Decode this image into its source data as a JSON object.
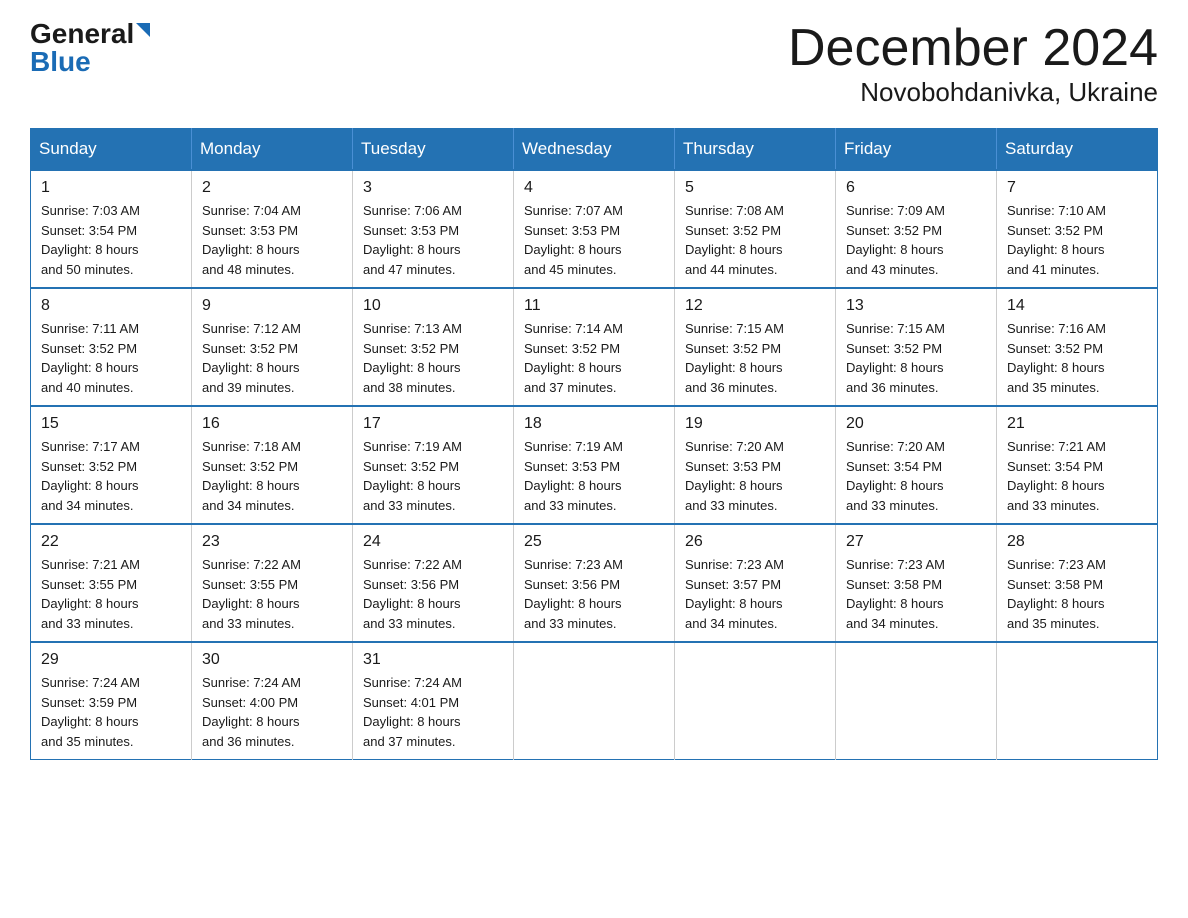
{
  "logo": {
    "general": "General",
    "blue": "Blue"
  },
  "header": {
    "month": "December 2024",
    "location": "Novobohdanivka, Ukraine"
  },
  "days_of_week": [
    "Sunday",
    "Monday",
    "Tuesday",
    "Wednesday",
    "Thursday",
    "Friday",
    "Saturday"
  ],
  "weeks": [
    [
      {
        "day": "1",
        "info": "Sunrise: 7:03 AM\nSunset: 3:54 PM\nDaylight: 8 hours\nand 50 minutes."
      },
      {
        "day": "2",
        "info": "Sunrise: 7:04 AM\nSunset: 3:53 PM\nDaylight: 8 hours\nand 48 minutes."
      },
      {
        "day": "3",
        "info": "Sunrise: 7:06 AM\nSunset: 3:53 PM\nDaylight: 8 hours\nand 47 minutes."
      },
      {
        "day": "4",
        "info": "Sunrise: 7:07 AM\nSunset: 3:53 PM\nDaylight: 8 hours\nand 45 minutes."
      },
      {
        "day": "5",
        "info": "Sunrise: 7:08 AM\nSunset: 3:52 PM\nDaylight: 8 hours\nand 44 minutes."
      },
      {
        "day": "6",
        "info": "Sunrise: 7:09 AM\nSunset: 3:52 PM\nDaylight: 8 hours\nand 43 minutes."
      },
      {
        "day": "7",
        "info": "Sunrise: 7:10 AM\nSunset: 3:52 PM\nDaylight: 8 hours\nand 41 minutes."
      }
    ],
    [
      {
        "day": "8",
        "info": "Sunrise: 7:11 AM\nSunset: 3:52 PM\nDaylight: 8 hours\nand 40 minutes."
      },
      {
        "day": "9",
        "info": "Sunrise: 7:12 AM\nSunset: 3:52 PM\nDaylight: 8 hours\nand 39 minutes."
      },
      {
        "day": "10",
        "info": "Sunrise: 7:13 AM\nSunset: 3:52 PM\nDaylight: 8 hours\nand 38 minutes."
      },
      {
        "day": "11",
        "info": "Sunrise: 7:14 AM\nSunset: 3:52 PM\nDaylight: 8 hours\nand 37 minutes."
      },
      {
        "day": "12",
        "info": "Sunrise: 7:15 AM\nSunset: 3:52 PM\nDaylight: 8 hours\nand 36 minutes."
      },
      {
        "day": "13",
        "info": "Sunrise: 7:15 AM\nSunset: 3:52 PM\nDaylight: 8 hours\nand 36 minutes."
      },
      {
        "day": "14",
        "info": "Sunrise: 7:16 AM\nSunset: 3:52 PM\nDaylight: 8 hours\nand 35 minutes."
      }
    ],
    [
      {
        "day": "15",
        "info": "Sunrise: 7:17 AM\nSunset: 3:52 PM\nDaylight: 8 hours\nand 34 minutes."
      },
      {
        "day": "16",
        "info": "Sunrise: 7:18 AM\nSunset: 3:52 PM\nDaylight: 8 hours\nand 34 minutes."
      },
      {
        "day": "17",
        "info": "Sunrise: 7:19 AM\nSunset: 3:52 PM\nDaylight: 8 hours\nand 33 minutes."
      },
      {
        "day": "18",
        "info": "Sunrise: 7:19 AM\nSunset: 3:53 PM\nDaylight: 8 hours\nand 33 minutes."
      },
      {
        "day": "19",
        "info": "Sunrise: 7:20 AM\nSunset: 3:53 PM\nDaylight: 8 hours\nand 33 minutes."
      },
      {
        "day": "20",
        "info": "Sunrise: 7:20 AM\nSunset: 3:54 PM\nDaylight: 8 hours\nand 33 minutes."
      },
      {
        "day": "21",
        "info": "Sunrise: 7:21 AM\nSunset: 3:54 PM\nDaylight: 8 hours\nand 33 minutes."
      }
    ],
    [
      {
        "day": "22",
        "info": "Sunrise: 7:21 AM\nSunset: 3:55 PM\nDaylight: 8 hours\nand 33 minutes."
      },
      {
        "day": "23",
        "info": "Sunrise: 7:22 AM\nSunset: 3:55 PM\nDaylight: 8 hours\nand 33 minutes."
      },
      {
        "day": "24",
        "info": "Sunrise: 7:22 AM\nSunset: 3:56 PM\nDaylight: 8 hours\nand 33 minutes."
      },
      {
        "day": "25",
        "info": "Sunrise: 7:23 AM\nSunset: 3:56 PM\nDaylight: 8 hours\nand 33 minutes."
      },
      {
        "day": "26",
        "info": "Sunrise: 7:23 AM\nSunset: 3:57 PM\nDaylight: 8 hours\nand 34 minutes."
      },
      {
        "day": "27",
        "info": "Sunrise: 7:23 AM\nSunset: 3:58 PM\nDaylight: 8 hours\nand 34 minutes."
      },
      {
        "day": "28",
        "info": "Sunrise: 7:23 AM\nSunset: 3:58 PM\nDaylight: 8 hours\nand 35 minutes."
      }
    ],
    [
      {
        "day": "29",
        "info": "Sunrise: 7:24 AM\nSunset: 3:59 PM\nDaylight: 8 hours\nand 35 minutes."
      },
      {
        "day": "30",
        "info": "Sunrise: 7:24 AM\nSunset: 4:00 PM\nDaylight: 8 hours\nand 36 minutes."
      },
      {
        "day": "31",
        "info": "Sunrise: 7:24 AM\nSunset: 4:01 PM\nDaylight: 8 hours\nand 37 minutes."
      },
      {
        "day": "",
        "info": ""
      },
      {
        "day": "",
        "info": ""
      },
      {
        "day": "",
        "info": ""
      },
      {
        "day": "",
        "info": ""
      }
    ]
  ]
}
